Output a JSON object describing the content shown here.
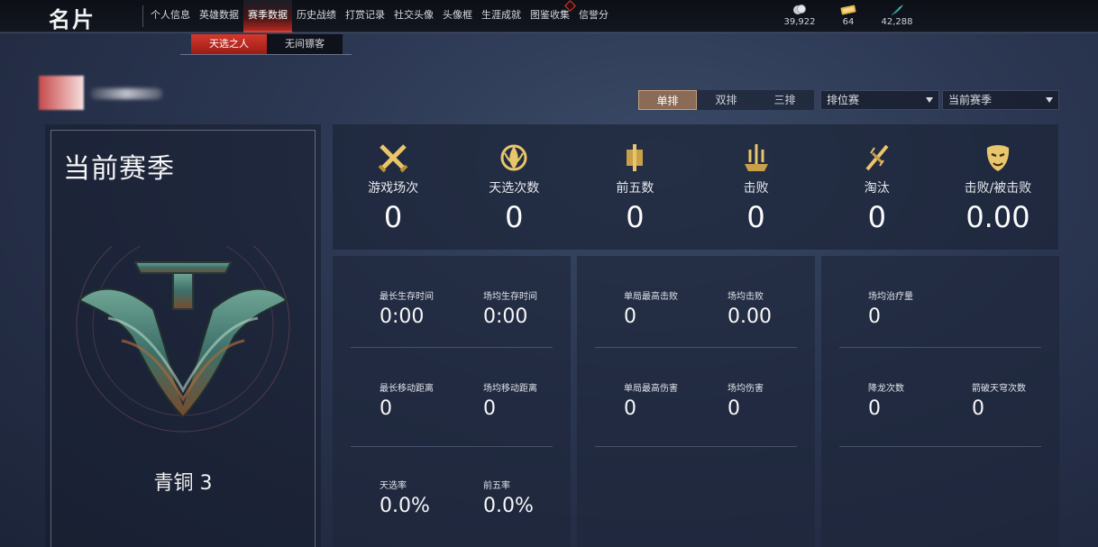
{
  "header": {
    "title": "名片",
    "nav": [
      "个人信息",
      "英雄数据",
      "赛季数据",
      "历史战绩",
      "打赏记录",
      "社交头像",
      "头像框",
      "生涯成就",
      "图鉴收集",
      "信誉分"
    ],
    "nav_active_index": 2,
    "nav_badge_index": 8,
    "currencies": [
      {
        "icon": "coin-icon",
        "value": "39,922"
      },
      {
        "icon": "ticket-icon",
        "value": "64"
      },
      {
        "icon": "feather-icon",
        "value": "42,288"
      }
    ]
  },
  "subtabs": {
    "items": [
      "天选之人",
      "无间镖客"
    ],
    "active_index": 0
  },
  "mode_tabs": {
    "items": [
      "单排",
      "双排",
      "三排"
    ],
    "active_index": 0
  },
  "dropdowns": {
    "match_type": "排位赛",
    "season": "当前赛季"
  },
  "season_panel": {
    "title": "当前赛季",
    "rank": "青铜 3"
  },
  "summary_stats": [
    {
      "icon": "crossed-swords-icon",
      "label": "游戏场次",
      "value": "0"
    },
    {
      "icon": "lotus-emblem-icon",
      "label": "天选次数",
      "value": "0"
    },
    {
      "icon": "banner-icon",
      "label": "前五数",
      "value": "0"
    },
    {
      "icon": "trident-icon",
      "label": "击败",
      "value": "0"
    },
    {
      "icon": "broken-blade-icon",
      "label": "淘汰",
      "value": "0"
    },
    {
      "icon": "mask-icon",
      "label": "击败/被击败",
      "value": "0.00"
    }
  ],
  "detail_survival": [
    {
      "label": "最长生存时间",
      "value": "0:00"
    },
    {
      "label": "场均生存时间",
      "value": "0:00"
    },
    {
      "label": "最长移动距离",
      "value": "0"
    },
    {
      "label": "场均移动距离",
      "value": "0"
    },
    {
      "label": "天选率",
      "value": "0.0%"
    },
    {
      "label": "前五率",
      "value": "0.0%"
    }
  ],
  "detail_combat": [
    {
      "label": "单局最高击败",
      "value": "0"
    },
    {
      "label": "场均击败",
      "value": "0.00"
    },
    {
      "label": "单局最高伤害",
      "value": "0"
    },
    {
      "label": "场均伤害",
      "value": "0"
    }
  ],
  "detail_support": [
    {
      "label": "场均治疗量",
      "value": "0"
    },
    {
      "label": "降龙次数",
      "value": "0"
    },
    {
      "label": "箭破天穹次数",
      "value": "0"
    }
  ],
  "colors": {
    "accent_red": "#e23b2e",
    "gold_icon": "#e9c56b",
    "mode_active": "#8a6b56"
  }
}
